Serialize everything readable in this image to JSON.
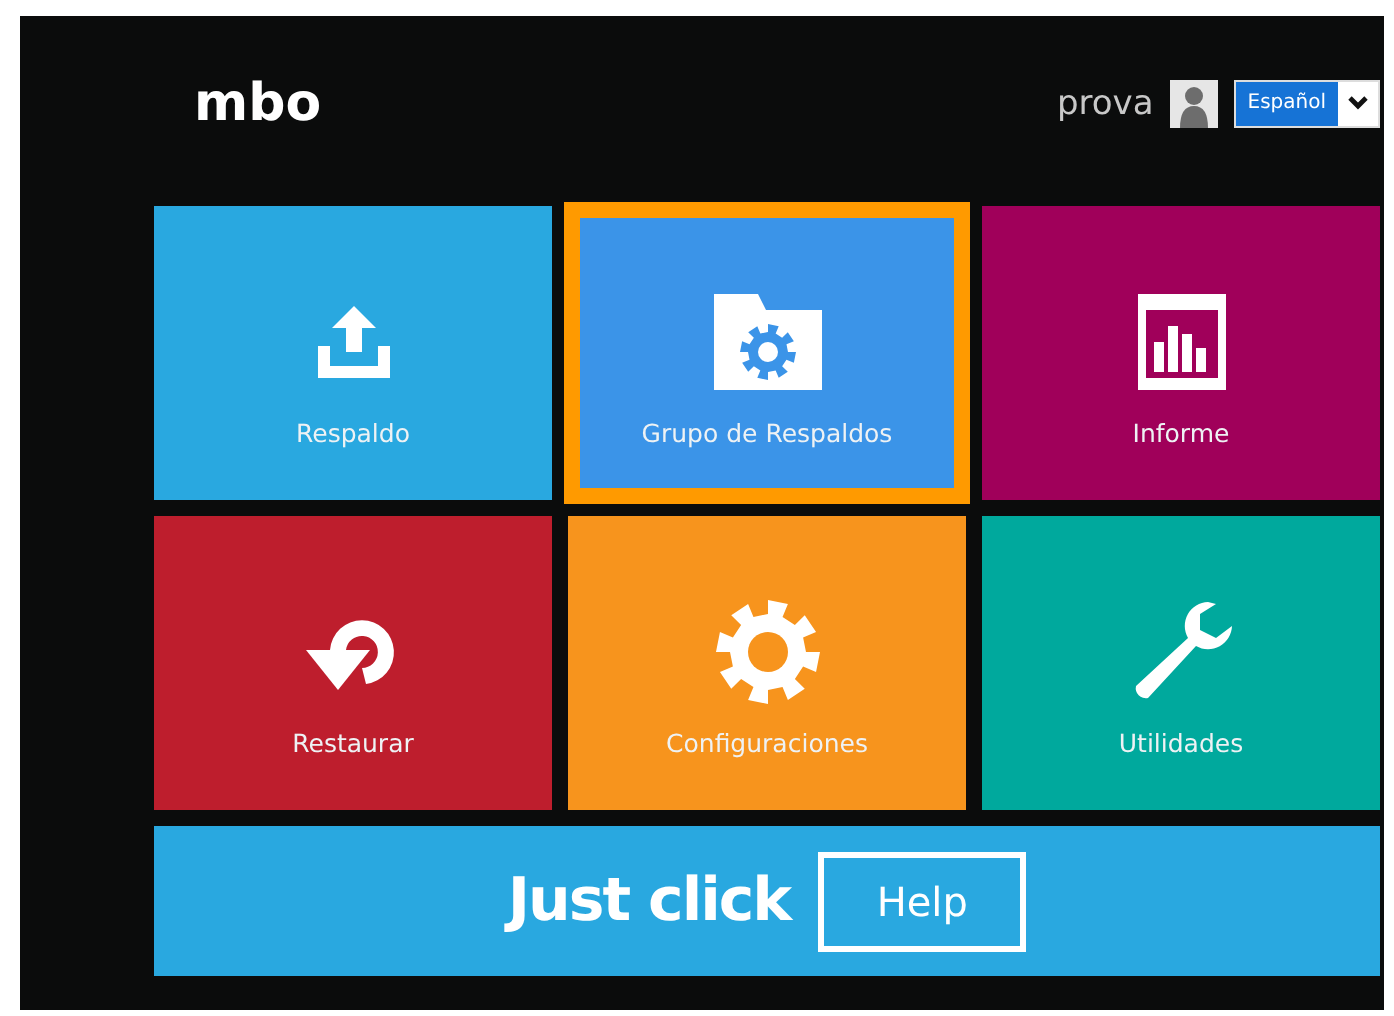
{
  "header": {
    "logo": "mbo",
    "user": "prova",
    "language": "Español"
  },
  "tiles": [
    {
      "label": "Respaldo",
      "kind": "upload",
      "color": "#29a8e0",
      "selected": false
    },
    {
      "label": "Grupo de Respaldos",
      "kind": "folder-gear",
      "color": "#3b94e8",
      "selected": true
    },
    {
      "label": "Informe",
      "kind": "chart",
      "color": "#a0005a",
      "selected": false
    },
    {
      "label": "Restaurar",
      "kind": "restore",
      "color": "#be1e2d",
      "selected": false
    },
    {
      "label": "Configuraciones",
      "kind": "gear",
      "color": "#f7941d",
      "selected": false
    },
    {
      "label": "Utilidades",
      "kind": "wrench",
      "color": "#00a99d",
      "selected": false
    }
  ],
  "banner": {
    "text": "Just click",
    "button": "Help"
  }
}
